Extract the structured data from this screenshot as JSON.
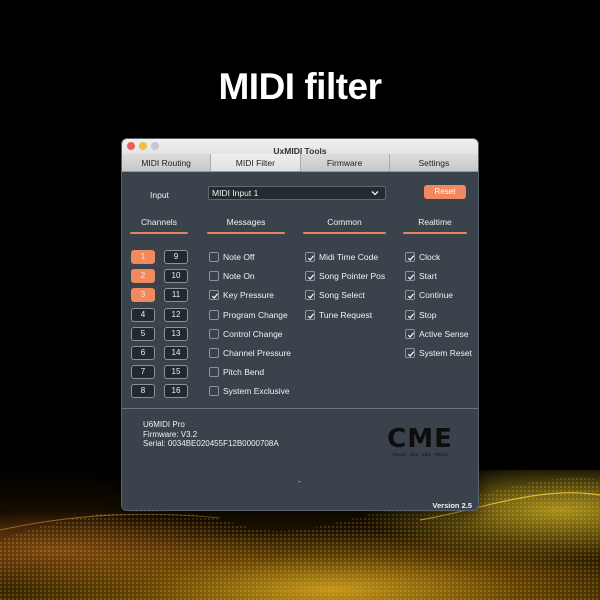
{
  "hero": {
    "title": "MIDI filter"
  },
  "window": {
    "title": "UxMIDI Tools",
    "tabs": [
      {
        "label": "MIDI Routing",
        "active": false
      },
      {
        "label": "MIDI Filter",
        "active": true
      },
      {
        "label": "Firmware",
        "active": false
      },
      {
        "label": "Settings",
        "active": false
      }
    ]
  },
  "filter": {
    "input_label": "Input",
    "input_value": "MIDI Input 1",
    "reset_label": "Reset",
    "columns": {
      "channels": "Channels",
      "messages": "Messages",
      "common": "Common",
      "realtime": "Realtime"
    },
    "channels": [
      {
        "num": "1",
        "on": true
      },
      {
        "num": "2",
        "on": true
      },
      {
        "num": "3",
        "on": true
      },
      {
        "num": "4",
        "on": false
      },
      {
        "num": "5",
        "on": false
      },
      {
        "num": "6",
        "on": false
      },
      {
        "num": "7",
        "on": false
      },
      {
        "num": "8",
        "on": false
      },
      {
        "num": "9",
        "on": false
      },
      {
        "num": "10",
        "on": false
      },
      {
        "num": "11",
        "on": false
      },
      {
        "num": "12",
        "on": false
      },
      {
        "num": "13",
        "on": false
      },
      {
        "num": "14",
        "on": false
      },
      {
        "num": "15",
        "on": false
      },
      {
        "num": "16",
        "on": false
      }
    ],
    "messages": [
      {
        "label": "Note Off",
        "checked": false
      },
      {
        "label": "Note On",
        "checked": false
      },
      {
        "label": "Key Pressure",
        "checked": true
      },
      {
        "label": "Program Change",
        "checked": false
      },
      {
        "label": "Control Change",
        "checked": false
      },
      {
        "label": "Channel Pressure",
        "checked": false
      },
      {
        "label": "Pitch Bend",
        "checked": false
      },
      {
        "label": "System Exclusive",
        "checked": false
      }
    ],
    "common": [
      {
        "label": "Midi Time Code",
        "checked": true
      },
      {
        "label": "Song Pointer Pos",
        "checked": true
      },
      {
        "label": "Song Select",
        "checked": true
      },
      {
        "label": "Tune Request",
        "checked": true
      }
    ],
    "realtime": [
      {
        "label": "Clock",
        "checked": true
      },
      {
        "label": "Start",
        "checked": true
      },
      {
        "label": "Continue",
        "checked": true
      },
      {
        "label": "Stop",
        "checked": true
      },
      {
        "label": "Active Sense",
        "checked": true
      },
      {
        "label": "System Reset",
        "checked": true
      }
    ]
  },
  "device": {
    "name": "U6MIDI Pro",
    "firmware": "Firmware: V3.2",
    "serial": "Serial: 0034BE020455F12B0000708A",
    "logo_text": "CME",
    "logo_tagline": "Always · One · Step · Ahead",
    "status_dash": "-",
    "version": "Version 2.5"
  },
  "colors": {
    "accent": "#f08a5d",
    "panel": "#3a434b",
    "field": "#232a30"
  }
}
